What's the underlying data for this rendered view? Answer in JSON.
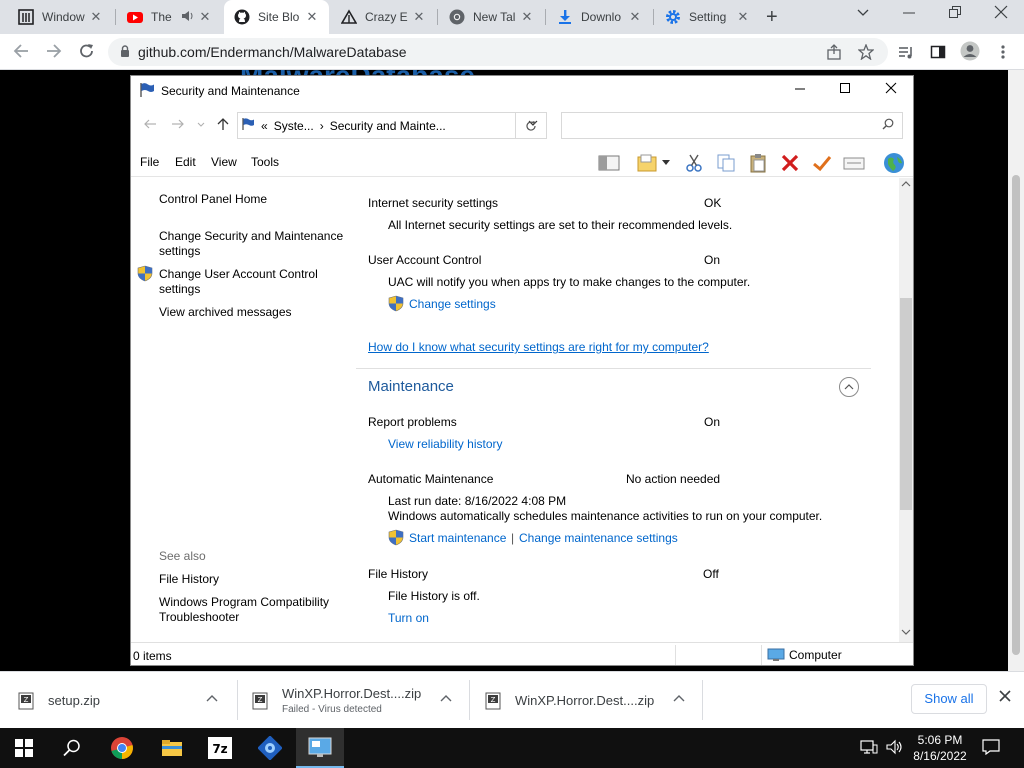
{
  "browser": {
    "tabs": [
      {
        "title": "Window",
        "icon": "archive-icon"
      },
      {
        "title": "The",
        "icon": "youtube-icon",
        "audio": true
      },
      {
        "title": "Site Blo",
        "icon": "github-icon"
      },
      {
        "title": "Crazy E",
        "icon": "crazy-icon"
      },
      {
        "title": "New Tal",
        "icon": "chrome-icon"
      },
      {
        "title": "Downlo",
        "icon": "download-icon"
      },
      {
        "title": "Setting",
        "icon": "gear-icon"
      }
    ],
    "active_tab": 2,
    "tab_close": "✕",
    "new_tab": "+",
    "url": "github.com/Endermanch/MalwareDatabase",
    "page_heading": "MalwareDatabase"
  },
  "window": {
    "title": "Security and Maintenance",
    "breadcrumb": {
      "prefix": "«",
      "items": [
        "Syste...",
        "Security and Mainte..."
      ],
      "sep": "›"
    },
    "menus": [
      "File",
      "Edit",
      "View",
      "Tools"
    ],
    "left_pane": {
      "home": "Control Panel Home",
      "links": [
        "Change Security and Maintenance settings",
        "Change User Account Control settings",
        "View archived messages"
      ],
      "see_also_label": "See also",
      "see_also": [
        "File History",
        "Windows Program Compatibility Troubleshooter"
      ]
    },
    "content": {
      "internet_security": {
        "label": "Internet security settings",
        "status": "OK",
        "desc": "All Internet security settings are set to their recommended levels."
      },
      "uac": {
        "label": "User Account Control",
        "status": "On",
        "desc": "UAC will notify you when apps try to make changes to the computer.",
        "link": "Change settings"
      },
      "help_link": "How do I know what security settings are right for my computer?",
      "maintenance": {
        "header": "Maintenance",
        "report_problems": {
          "label": "Report problems",
          "status": "On",
          "link": "View reliability history"
        },
        "automatic": {
          "label": "Automatic Maintenance",
          "status": "No action needed",
          "last_run": "Last run date: 8/16/2022 4:08 PM",
          "desc": "Windows automatically schedules maintenance activities to run on your computer.",
          "link_start": "Start maintenance",
          "link_sep": "|",
          "link_change": "Change maintenance settings"
        },
        "file_history": {
          "label": "File History",
          "status": "Off",
          "desc": "File History is off.",
          "link": "Turn on"
        }
      }
    },
    "status_bar": {
      "items": "0 items",
      "location": "Computer"
    }
  },
  "downloads": {
    "items": [
      {
        "name": "setup.zip",
        "status": ""
      },
      {
        "name": "WinXP.Horror.Dest....zip",
        "status": "Failed - Virus detected"
      },
      {
        "name": "WinXP.Horror.Dest....zip",
        "status": ""
      }
    ],
    "show_all": "Show all"
  },
  "taskbar": {
    "time": "5:06 PM",
    "date": "8/16/2022"
  },
  "colors": {
    "link": "#0066cc",
    "header": "#1e5a9c",
    "chrome_bg": "#dee1e6",
    "taskbar": "#101010"
  }
}
